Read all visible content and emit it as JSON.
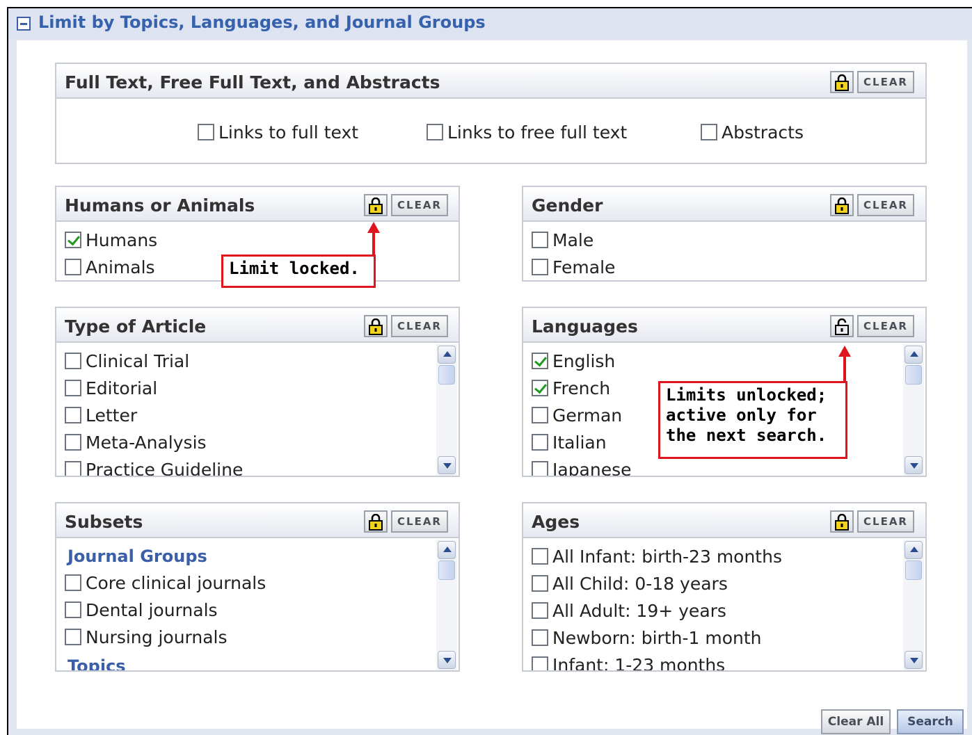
{
  "header": {
    "title": "Limit by Topics, Languages, and Journal Groups"
  },
  "clear_label": "CLEAR",
  "full_text": {
    "title": "Full Text, Free Full Text, and Abstracts",
    "options": [
      {
        "label": "Links to full text",
        "checked": false
      },
      {
        "label": "Links to free full text",
        "checked": false
      },
      {
        "label": "Abstracts",
        "checked": false
      }
    ]
  },
  "humans": {
    "title": "Humans or Animals",
    "options": [
      {
        "label": "Humans",
        "checked": true
      },
      {
        "label": "Animals",
        "checked": false
      }
    ],
    "callout": "Limit locked."
  },
  "gender": {
    "title": "Gender",
    "options": [
      {
        "label": "Male",
        "checked": false
      },
      {
        "label": "Female",
        "checked": false
      }
    ]
  },
  "article_type": {
    "title": "Type of Article",
    "options": [
      {
        "label": "Clinical Trial",
        "checked": false
      },
      {
        "label": "Editorial",
        "checked": false
      },
      {
        "label": "Letter",
        "checked": false
      },
      {
        "label": "Meta-Analysis",
        "checked": false
      },
      {
        "label": "Practice Guideline",
        "checked": false
      }
    ]
  },
  "languages": {
    "title": "Languages",
    "options": [
      {
        "label": "English",
        "checked": true
      },
      {
        "label": "French",
        "checked": true
      },
      {
        "label": "German",
        "checked": false
      },
      {
        "label": "Italian",
        "checked": false
      },
      {
        "label": "Japanese",
        "checked": false
      }
    ],
    "callout": "Limits unlocked;\nactive only for\nthe next search."
  },
  "subsets": {
    "title": "Subsets",
    "group_journal": "Journal Groups",
    "options": [
      {
        "label": "Core clinical journals",
        "checked": false
      },
      {
        "label": "Dental journals",
        "checked": false
      },
      {
        "label": "Nursing journals",
        "checked": false
      }
    ],
    "group_topics": "Topics"
  },
  "ages": {
    "title": "Ages",
    "options": [
      {
        "label": "All Infant: birth-23 months",
        "checked": false
      },
      {
        "label": "All Child: 0-18 years",
        "checked": false
      },
      {
        "label": "All Adult: 19+ years",
        "checked": false
      },
      {
        "label": "Newborn: birth-1 month",
        "checked": false
      },
      {
        "label": "Infant: 1-23 months",
        "checked": false
      }
    ]
  },
  "footer": {
    "clear_all": "Clear All",
    "search": "Search"
  },
  "colors": {
    "accent": "#3561ad",
    "callout": "#e0141e",
    "check": "#1f9a1f"
  },
  "icons": {
    "lock": "padlock-icon",
    "unlock": "unlock-icon",
    "collapse": "minus-box-icon"
  }
}
